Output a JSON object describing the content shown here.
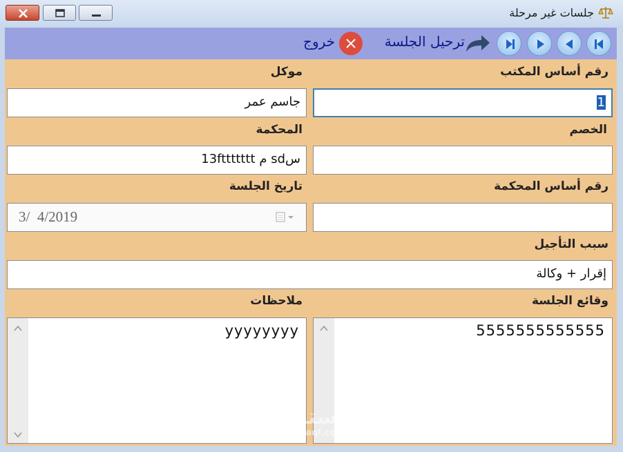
{
  "window": {
    "title": "جلسات غير مرحلة",
    "title_icon": "scales-icon"
  },
  "toolbar": {
    "nav_first": "first-record-icon",
    "nav_prev": "previous-record-icon",
    "nav_next": "next-record-icon",
    "nav_last": "last-record-icon",
    "postpone_label": "ترحيل الجلسة",
    "exit_label": "خروج"
  },
  "form": {
    "office_number": {
      "label": "رقم أساس المكتب",
      "value": "1"
    },
    "client": {
      "label": "موكل",
      "value": "جاسم عمر"
    },
    "opponent": {
      "label": "الخصم",
      "value": ""
    },
    "court": {
      "label": "المحكمة",
      "value": "سsd م 13fttttttt"
    },
    "court_number": {
      "label": "رقم أساس المحكمة",
      "value": ""
    },
    "session_date": {
      "label": "تاريخ الجلسة",
      "value": "3/  4/2019"
    },
    "postpone_reason": {
      "label": "سبب التأجيل",
      "value": "إقرار + وكالة"
    },
    "session_facts": {
      "label": "وقائع الجلسة",
      "value": "5555555555555"
    },
    "notes": {
      "label": "ملاحظات",
      "value": "yyyyyyyy"
    }
  },
  "watermark": {
    "main": "مستقل",
    "sub": "mostaql.com"
  },
  "colors": {
    "form_bg": "#f0c68f",
    "toolbar_bg": "#9aa1e0",
    "label_link": "#0a1a8a",
    "exit_red": "#dc4d3d"
  }
}
